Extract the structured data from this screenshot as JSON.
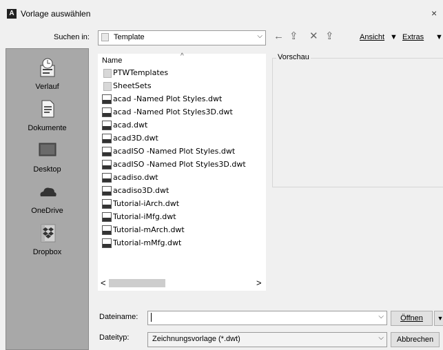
{
  "window": {
    "title": "Vorlage auswählen",
    "icon_letter": "A",
    "close_glyph": "×"
  },
  "toolbar": {
    "lookin_label": "Suchen in:",
    "lookin_value": "Template",
    "view_label": "Ansicht",
    "tools_label": "Extras",
    "back_glyph": "←",
    "up_glyph": "⇪",
    "delete_glyph": "✕",
    "newfolder_glyph": "⇪",
    "dropdown_glyph": "▼",
    "combo_glyph": "⌵"
  },
  "places": [
    {
      "label": "Verlauf",
      "icon": "history-icon"
    },
    {
      "label": "Dokumente",
      "icon": "documents-icon"
    },
    {
      "label": "Desktop",
      "icon": "desktop-icon"
    },
    {
      "label": "OneDrive",
      "icon": "onedrive-icon"
    },
    {
      "label": "Dropbox",
      "icon": "dropbox-icon"
    }
  ],
  "filelist": {
    "column_name": "Name",
    "sort_glyph": "^",
    "items": [
      {
        "name": "PTWTemplates",
        "type": "folder"
      },
      {
        "name": "SheetSets",
        "type": "folder"
      },
      {
        "name": "acad -Named Plot Styles.dwt",
        "type": "dwt"
      },
      {
        "name": "acad -Named Plot Styles3D.dwt",
        "type": "dwt"
      },
      {
        "name": "acad.dwt",
        "type": "dwt"
      },
      {
        "name": "acad3D.dwt",
        "type": "dwt"
      },
      {
        "name": "acadISO -Named Plot Styles.dwt",
        "type": "dwt"
      },
      {
        "name": "acadISO -Named Plot Styles3D.dwt",
        "type": "dwt"
      },
      {
        "name": "acadiso.dwt",
        "type": "dwt"
      },
      {
        "name": "acadiso3D.dwt",
        "type": "dwt"
      },
      {
        "name": "Tutorial-iArch.dwt",
        "type": "dwt"
      },
      {
        "name": "Tutorial-iMfg.dwt",
        "type": "dwt"
      },
      {
        "name": "Tutorial-mArch.dwt",
        "type": "dwt"
      },
      {
        "name": "Tutorial-mMfg.dwt",
        "type": "dwt"
      }
    ],
    "scroll_left": "<",
    "scroll_right": ">"
  },
  "preview": {
    "label": "Vorschau"
  },
  "bottom": {
    "filename_label": "Dateiname:",
    "filename_value": "",
    "filetype_label": "Dateityp:",
    "filetype_value": "Zeichnungsvorlage (*.dwt)",
    "open_label": "Öffnen",
    "cancel_label": "Abbrechen"
  }
}
